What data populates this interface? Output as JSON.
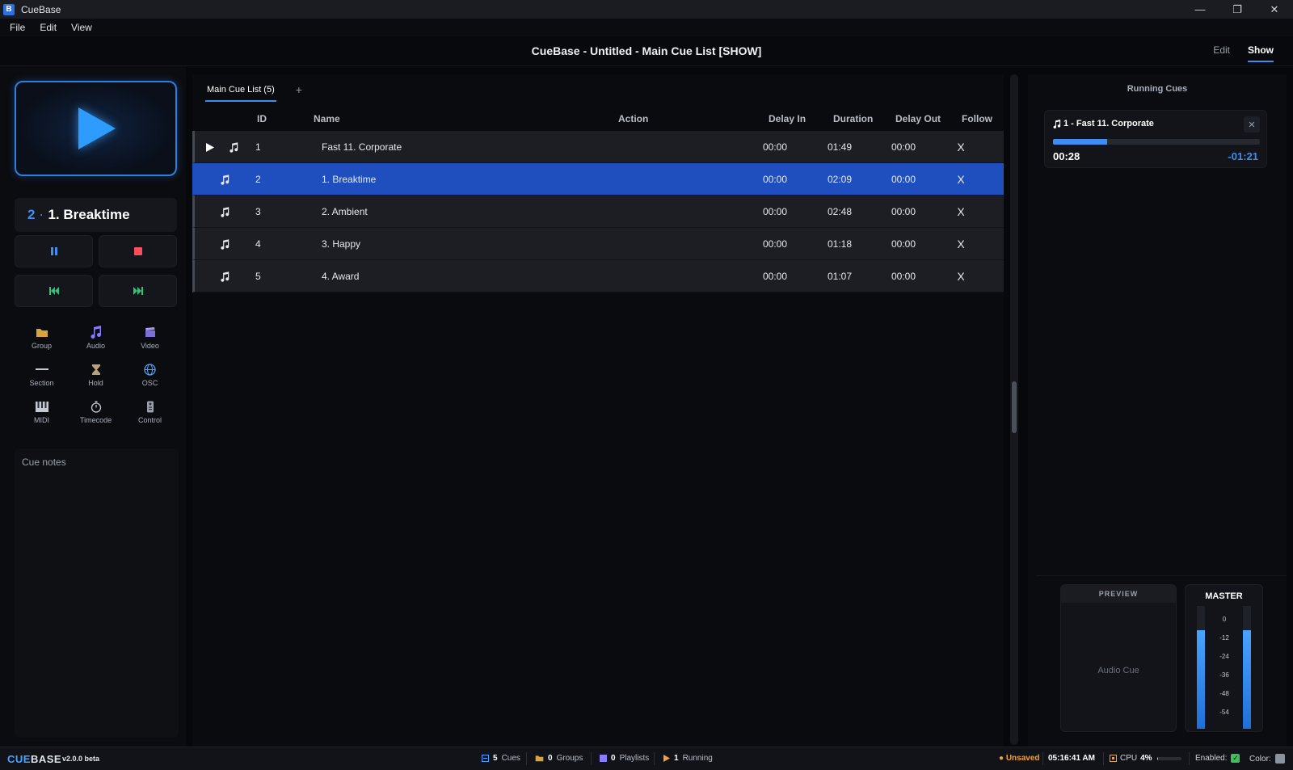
{
  "window": {
    "logo": "B",
    "app_name": "CueBase",
    "controls": {
      "minimize": "—",
      "restore": "❐",
      "close": "✕"
    }
  },
  "menu": [
    "File",
    "Edit",
    "View"
  ],
  "header": {
    "title": "CueBase - Untitled - Main Cue List [SHOW]",
    "modes": [
      {
        "label": "Edit",
        "active": false
      },
      {
        "label": "Show",
        "active": true
      }
    ]
  },
  "left": {
    "current_cue": {
      "id": "2",
      "separator": "·",
      "name": "1. Breaktime"
    },
    "cue_types": [
      "Group",
      "Audio",
      "Video",
      "Section",
      "Hold",
      "OSC",
      "MIDI",
      "Timecode",
      "Control"
    ],
    "cue_notes_label": "Cue notes"
  },
  "cue_list": {
    "tab_label": "Main Cue List (5)",
    "add_tab": "+",
    "columns": [
      "ID",
      "Name",
      "Action",
      "Delay In",
      "Duration",
      "Delay Out",
      "Follow"
    ],
    "rows": [
      {
        "playing": true,
        "selected": false,
        "id": "1",
        "name": "Fast 11. Corporate",
        "action": "",
        "delay_in": "00:00",
        "duration": "01:49",
        "delay_out": "00:00",
        "follow": "X"
      },
      {
        "playing": false,
        "selected": true,
        "id": "2",
        "name": "1. Breaktime",
        "action": "",
        "delay_in": "00:00",
        "duration": "02:09",
        "delay_out": "00:00",
        "follow": "X"
      },
      {
        "playing": false,
        "selected": false,
        "id": "3",
        "name": "2. Ambient",
        "action": "",
        "delay_in": "00:00",
        "duration": "02:48",
        "delay_out": "00:00",
        "follow": "X"
      },
      {
        "playing": false,
        "selected": false,
        "id": "4",
        "name": "3. Happy",
        "action": "",
        "delay_in": "00:00",
        "duration": "01:18",
        "delay_out": "00:00",
        "follow": "X"
      },
      {
        "playing": false,
        "selected": false,
        "id": "5",
        "name": "4. Award",
        "action": "",
        "delay_in": "00:00",
        "duration": "01:07",
        "delay_out": "00:00",
        "follow": "X"
      }
    ]
  },
  "running_cues": {
    "title": "Running Cues",
    "close": "✕",
    "items": [
      {
        "label": "1 - Fast 11. Corporate",
        "elapsed": "00:28",
        "remaining": "-01:21",
        "progress": 0.26
      }
    ]
  },
  "preview": {
    "label": "PREVIEW",
    "body": "Audio Cue"
  },
  "master": {
    "label": "MASTER",
    "scale": [
      "0",
      "-12",
      "-24",
      "-36",
      "-48",
      "-54"
    ],
    "level_left": 0.8,
    "level_right": 0.8
  },
  "status": {
    "brand_a": "CUE",
    "brand_b": "BASE",
    "version": "v2.0.0 beta",
    "cues_count": "5",
    "cues_label": "Cues",
    "groups_count": "0",
    "groups_label": "Groups",
    "playlists_count": "0",
    "playlists_label": "Playlists",
    "running_count": "1",
    "running_label": "Running",
    "unsaved": "● Unsaved",
    "clock": "05:16:41 AM",
    "cpu_label": "CPU",
    "cpu_value": "4%",
    "cpu_level": 0.04,
    "enabled_label": "Enabled:",
    "color_label": "Color:"
  },
  "colors": {
    "accent": "#3d8ef0",
    "selected_row": "#1f4fbf",
    "warning": "#f0a23b",
    "ok": "#3fbf5a"
  }
}
